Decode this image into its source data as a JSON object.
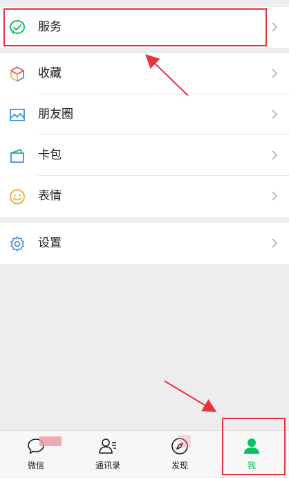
{
  "menu": {
    "service": {
      "label": "服务",
      "icon": "service-check-icon"
    },
    "items": [
      {
        "label": "收藏",
        "icon": "favorites-cube-icon"
      },
      {
        "label": "朋友圈",
        "icon": "moments-image-icon"
      },
      {
        "label": "卡包",
        "icon": "card-wallet-icon"
      },
      {
        "label": "表情",
        "icon": "sticker-smile-icon"
      }
    ],
    "settings": {
      "label": "设置",
      "icon": "gear-icon"
    }
  },
  "tabbar": {
    "tabs": [
      {
        "label": "微信",
        "icon": "chat-bubble-icon"
      },
      {
        "label": "通讯录",
        "icon": "contacts-icon"
      },
      {
        "label": "发现",
        "icon": "compass-icon"
      },
      {
        "label": "我",
        "icon": "person-icon",
        "active": true
      }
    ]
  },
  "colors": {
    "accent_green": "#07c160",
    "annotation_red": "#e8333f"
  }
}
